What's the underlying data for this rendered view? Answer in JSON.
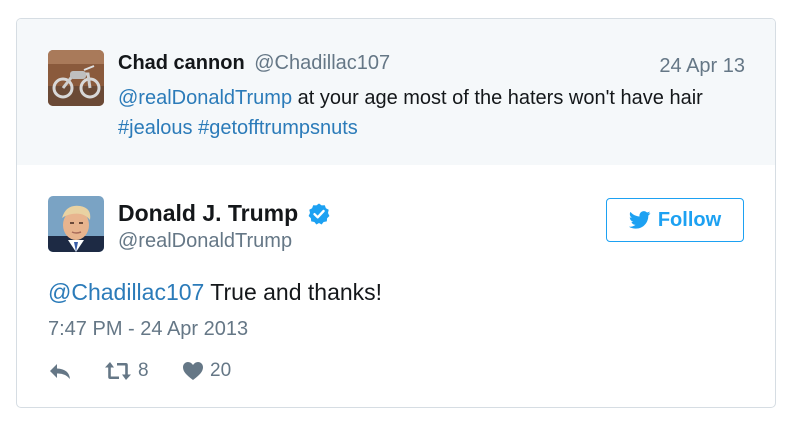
{
  "reply_context": {
    "author_name": "Chad cannon",
    "author_handle": "@Chadillac107",
    "date": "24 Apr 13",
    "mention": "@realDonaldTrump",
    "text": " at your age most of the haters won't have hair ",
    "hashtag_1": "#jealous",
    "hashtag_2": "#getofftrumpsnuts"
  },
  "tweet": {
    "author_name": "Donald J. Trump",
    "author_handle": "@realDonaldTrump",
    "follow_label": "Follow",
    "mention": "@Chadillac107",
    "text": " True and thanks!",
    "timestamp": "7:47 PM - 24 Apr 2013",
    "retweet_count": "8",
    "like_count": "20"
  },
  "colors": {
    "link": "#2b7bb9",
    "follow": "#1da1f2",
    "muted": "#657786",
    "context_background": "#f5f8fa"
  },
  "icons": {
    "reply": "reply-arrow-icon",
    "retweet": "retweet-icon",
    "like": "heart-icon",
    "verified": "verified-badge-icon",
    "follow": "bird-icon"
  }
}
